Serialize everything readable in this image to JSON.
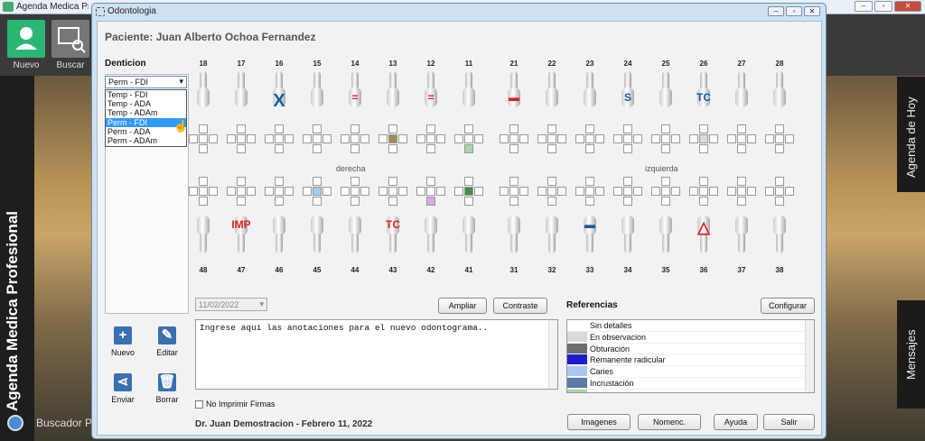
{
  "app": {
    "title": "Agenda Medica Profesio",
    "vertical_title": "Agenda Medica Profesional",
    "nuevo": "Nuevo",
    "buscar": "Buscar",
    "buscador": "Buscador P",
    "agenda_hoy": "Agenda de Hoy",
    "mensajes": "Mensajes"
  },
  "window": {
    "title": "Odontologia"
  },
  "patient": {
    "label": "Paciente: Juan Alberto Ochoa Fernandez"
  },
  "denticion": {
    "label": "Denticion",
    "selected": "Perm - FDI",
    "options": [
      "Temp - FDI",
      "Temp - ADA",
      "Temp - ADAm",
      "Perm - FDI",
      "Perm - ADA",
      "Perm - ADAm"
    ]
  },
  "upper_numbers": [
    "18",
    "17",
    "16",
    "15",
    "14",
    "13",
    "12",
    "11",
    "21",
    "22",
    "23",
    "24",
    "25",
    "26",
    "27",
    "28"
  ],
  "lower_numbers": [
    "48",
    "47",
    "46",
    "45",
    "44",
    "43",
    "42",
    "41",
    "31",
    "32",
    "33",
    "34",
    "35",
    "36",
    "37",
    "38"
  ],
  "upper_marks": [
    "",
    "",
    "X",
    "",
    "=",
    "",
    "=",
    "",
    "▬",
    "",
    "",
    "S",
    "",
    "TC",
    "",
    ""
  ],
  "lower_marks": [
    "",
    "IMP",
    "",
    "",
    "",
    "TC",
    "",
    "",
    "",
    "",
    "▬",
    "",
    "",
    "△",
    "",
    ""
  ],
  "sides": {
    "right": "derecha",
    "left": "izquierda"
  },
  "actions": {
    "nuevo": "Nuevo",
    "editar": "Editar",
    "enviar": "Enviar",
    "borrar": "Borrar"
  },
  "date": "11/02/2022",
  "buttons": {
    "ampliar": "Ampliar",
    "contraste": "Contraste",
    "configurar": "Configurar",
    "imagenes": "Imagenes",
    "nomenc": "Nomenc.",
    "ayuda": "Ayuda",
    "salir": "Salir"
  },
  "notes_placeholder": "Ingrese aquí las anotaciones para el nuevo odontograma..",
  "no_imprimir": "No Imprimir Firmas",
  "doctor": "Dr. Juan Demostracion - Febrero 11, 2022",
  "referencias": {
    "title": "Referencias",
    "items": [
      {
        "label": "Sin detalles",
        "color": "#ffffff"
      },
      {
        "label": "En observacion",
        "color": "#d9d9d9"
      },
      {
        "label": "Obturación",
        "color": "#6e6e6e"
      },
      {
        "label": "Remanente radicular",
        "color": "#1c1ccc"
      },
      {
        "label": "Caries",
        "color": "#a9c8ee"
      },
      {
        "label": "Incrustación",
        "color": "#5a7aa6"
      },
      {
        "label": "",
        "color": "#a6d8a0"
      }
    ]
  },
  "colors": {
    "mark_red": "#e0202a",
    "mark_blue": "#1d5a9a"
  }
}
